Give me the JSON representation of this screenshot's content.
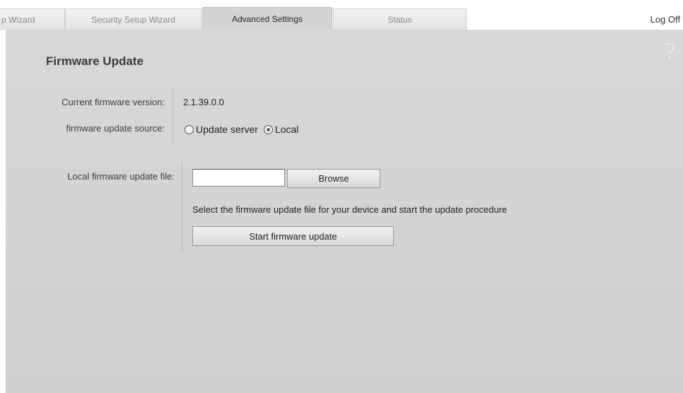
{
  "tabs": [
    {
      "label": "p Wizard",
      "active": false
    },
    {
      "label": "Security Setup Wizard",
      "active": false
    },
    {
      "label": "Advanced Settings",
      "active": true
    },
    {
      "label": "Status",
      "active": false
    }
  ],
  "header": {
    "logoff_label": "Log Off",
    "help_symbol": "?"
  },
  "page": {
    "title": "Firmware Update"
  },
  "firmware": {
    "current_version_label": "Current firmware version:",
    "current_version_value": "2.1.39.0.0",
    "source_label": "firmware update source:",
    "source_options": [
      {
        "label": "Update server",
        "checked": false
      },
      {
        "label": "Local",
        "checked": true
      }
    ],
    "local_file_label": "Local firmware update file:",
    "local_file_value": "",
    "browse_label": "Browse",
    "hint_text": "Select the firmware update file for your device and start the update procedure",
    "start_label": "Start firmware update"
  },
  "colors": {
    "panel_background": "#d4d4d4",
    "active_tab": "#d4d4d4",
    "inactive_tab": "#ececec"
  }
}
